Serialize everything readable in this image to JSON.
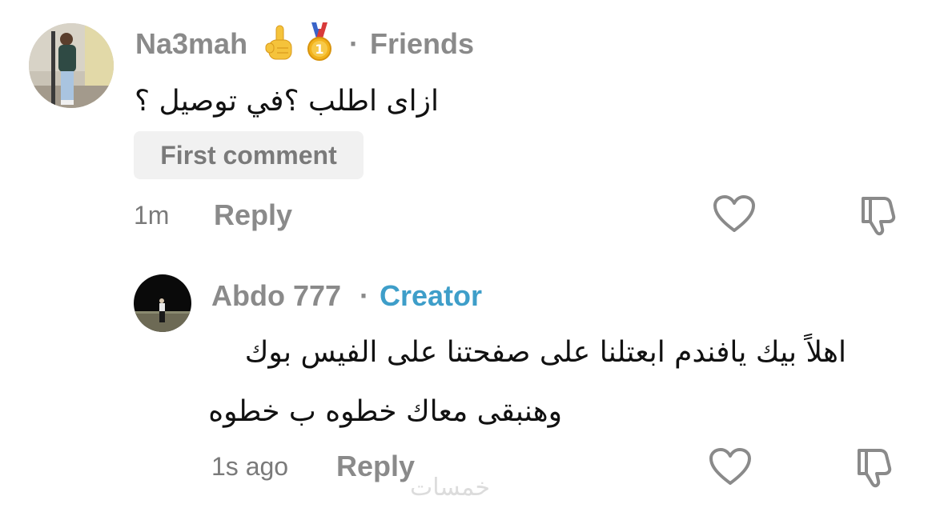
{
  "comments": [
    {
      "username": "Na3mah",
      "separator": "·",
      "tag": "Friends",
      "text": "ازاى اطلب ؟في توصيل ؟",
      "badge": "First comment",
      "time": "1m",
      "reply_label": "Reply"
    }
  ],
  "replies": [
    {
      "username": "Abdo 777",
      "separator": "·",
      "tag": "Creator",
      "text_line1": "اهلاً بيك يافندم ابعتلنا على صفحتنا على الفيس بوك",
      "text_line2": "وهنبقى معاك خطوه ب خطوه",
      "time": "1s ago",
      "reply_label": "Reply"
    }
  ],
  "watermark": "خمسات",
  "colors": {
    "muted_text": "#8a8a8a",
    "creator_tag": "#3e9ec9",
    "badge_bg": "#f1f1f1"
  },
  "icons": {
    "like": "heart-outline-icon",
    "dislike": "thumbs-down-outline-icon",
    "emoji1": "pointing-up-hand-emoji",
    "emoji2": "first-place-medal-emoji"
  }
}
